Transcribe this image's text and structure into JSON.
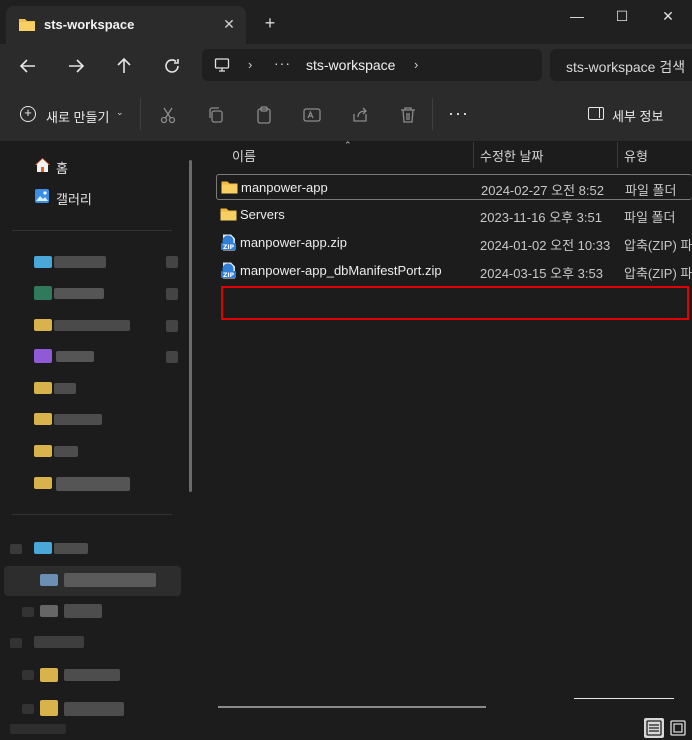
{
  "window": {
    "tab_title": "sts-workspace",
    "tab_close": "✕",
    "new_tab": "+",
    "minimize": "—",
    "maximize": "☐",
    "close": "✕"
  },
  "nav": {
    "back": "←",
    "forward": "→",
    "up": "↑",
    "refresh": "↻",
    "address": {
      "chevron": "›",
      "overflow": "···",
      "crumb": "sts-workspace",
      "chevron_after": "›"
    },
    "search_placeholder": "sts-workspace 검색"
  },
  "commands": {
    "new_label": "새로 만들기",
    "new_dropdown": "⌄",
    "more": "···",
    "details_label": "세부 정보"
  },
  "sidebar": {
    "home_label": "홈",
    "gallery_label": "갤러리"
  },
  "columns": {
    "name": "이름",
    "modified": "수정한 날짜",
    "type": "유형"
  },
  "files": [
    {
      "name": "manpower-app",
      "modified": "2024-02-27 오전 8:52",
      "type": "파일 폴더",
      "icon": "folder-icon"
    },
    {
      "name": "Servers",
      "modified": "2023-11-16 오후 3:51",
      "type": "파일 폴더",
      "icon": "folder-icon"
    },
    {
      "name": "manpower-app.zip",
      "modified": "2024-01-02 오전 10:33",
      "type": "압축(ZIP) 파",
      "icon": "zip-icon"
    },
    {
      "name": "manpower-app_dbManifestPort.zip",
      "modified": "2024-03-15 오후 3:53",
      "type": "압축(ZIP) 파",
      "icon": "zip-icon"
    }
  ],
  "colors": {
    "accent_highlight": "#e00000",
    "folder": "#f4c04a",
    "zip": "#3b8de0"
  }
}
